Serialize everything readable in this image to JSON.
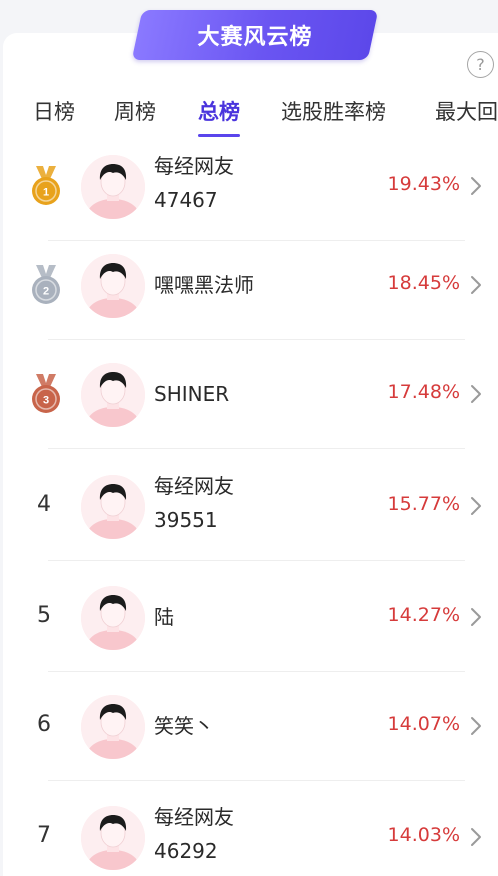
{
  "banner": {
    "title": "大赛风云榜"
  },
  "help": {
    "glyph": "?"
  },
  "tabs": [
    {
      "label": "日榜",
      "active": false
    },
    {
      "label": "周榜",
      "active": false
    },
    {
      "label": "总榜",
      "active": true
    },
    {
      "label": "选股胜率榜",
      "active": false
    },
    {
      "label": "最大回",
      "active": false
    }
  ],
  "colors": {
    "accent": "#5a45ec",
    "percent": "#d63b3b",
    "gold": "#e8a21c",
    "silver": "#a9b1bd",
    "bronze": "#c8644a"
  },
  "rankings": [
    {
      "rank": "1",
      "medal": "gold",
      "name_line1": "每经网友",
      "name_line2": "47467",
      "percent": "19.43%"
    },
    {
      "rank": "2",
      "medal": "silver",
      "name_line1": "嘿嘿黑法师",
      "name_line2": "",
      "percent": "18.45%"
    },
    {
      "rank": "3",
      "medal": "bronze",
      "name_line1": "SHINER",
      "name_line2": "",
      "percent": "17.48%"
    },
    {
      "rank": "4",
      "medal": "",
      "name_line1": "每经网友",
      "name_line2": "39551",
      "percent": "15.77%"
    },
    {
      "rank": "5",
      "medal": "",
      "name_line1": "陆",
      "name_line2": "",
      "percent": "14.27%"
    },
    {
      "rank": "6",
      "medal": "",
      "name_line1": "笑笑丶",
      "name_line2": "",
      "percent": "14.07%"
    },
    {
      "rank": "7",
      "medal": "",
      "name_line1": "每经网友",
      "name_line2": "46292",
      "percent": "14.03%"
    }
  ]
}
